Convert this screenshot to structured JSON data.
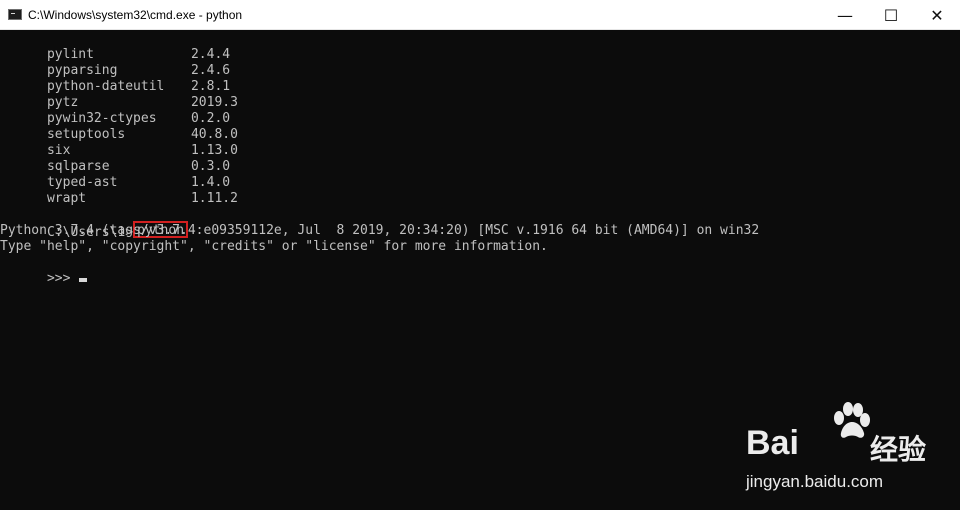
{
  "window": {
    "title": "C:\\Windows\\system32\\cmd.exe - python",
    "controls": {
      "minimize": "—",
      "maximize": "☐",
      "close": "✕"
    }
  },
  "console": {
    "packages": [
      {
        "name": "pylint",
        "version": "2.4.4"
      },
      {
        "name": "pyparsing",
        "version": "2.4.6"
      },
      {
        "name": "python-dateutil",
        "version": "2.8.1"
      },
      {
        "name": "pytz",
        "version": "2019.3"
      },
      {
        "name": "pywin32-ctypes",
        "version": "0.2.0"
      },
      {
        "name": "setuptools",
        "version": "40.8.0"
      },
      {
        "name": "six",
        "version": "1.13.0"
      },
      {
        "name": "sqlparse",
        "version": "0.3.0"
      },
      {
        "name": "typed-ast",
        "version": "1.4.0"
      },
      {
        "name": "wrapt",
        "version": "1.11.2"
      }
    ],
    "prompt": "C:\\Users\\1>",
    "command": "python",
    "banner_line_1": "Python 3.7.4 (tags/v3.7.4:e09359112e, Jul  8 2019, 20:34:20) [MSC v.1916 64 bit (AMD64)] on win32",
    "banner_line_2": "Type \"help\", \"copyright\", \"credits\" or \"license\" for more information.",
    "repl_prompt": ">>> "
  },
  "watermark": {
    "brand": "Bai",
    "brand_suffix": "经验",
    "url": "jingyan.baidu.com",
    "icon": "baidu-paw-icon"
  },
  "colors": {
    "background": "#0c0c0c",
    "console_text": "#c0c0c0",
    "highlight_border": "#d12020",
    "titlebar": "#ffffff"
  }
}
